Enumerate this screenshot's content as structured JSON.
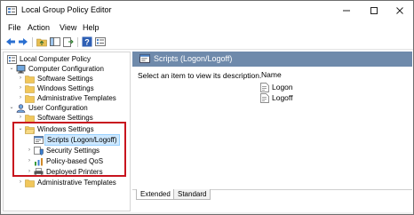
{
  "window": {
    "title": "Local Group Policy Editor"
  },
  "menu": [
    "File",
    "Action",
    "View",
    "Help"
  ],
  "toolbar": {
    "icons": [
      "back-arrow-icon",
      "forward-arrow-icon",
      "up-folder-icon",
      "show-hide-tree-icon",
      "export-list-icon",
      "help-icon",
      "properties-icon"
    ]
  },
  "tree": [
    {
      "label": "Local Computer Policy",
      "icon": "computer-policy-icon"
    },
    {
      "label": "Computer Configuration",
      "icon": "computer-icon"
    },
    {
      "label": "Software Settings",
      "icon": "folder-icon"
    },
    {
      "label": "Windows Settings",
      "icon": "folder-icon"
    },
    {
      "label": "Administrative Templates",
      "icon": "folder-icon"
    },
    {
      "label": "User Configuration",
      "icon": "user-icon"
    },
    {
      "label": "Software Settings",
      "icon": "folder-icon"
    },
    {
      "label": "Windows Settings",
      "icon": "folder-open-icon"
    },
    {
      "label": "Scripts (Logon/Logoff)",
      "icon": "scripts-icon",
      "selected": true
    },
    {
      "label": "Security Settings",
      "icon": "security-icon"
    },
    {
      "label": "Policy-based QoS",
      "icon": "qos-icon"
    },
    {
      "label": "Deployed Printers",
      "icon": "printer-icon"
    },
    {
      "label": "Administrative Templates",
      "icon": "folder-icon"
    }
  ],
  "right_pane": {
    "header": "Scripts (Logon/Logoff)",
    "description": "Select an item to view its description.",
    "column_header": "Name",
    "items": [
      "Logon",
      "Logoff"
    ]
  },
  "tabs": [
    "Extended",
    "Standard"
  ],
  "colors": {
    "header": "#6f8aab",
    "highlight_box": "#c8141e",
    "selection": "#cde8ff"
  }
}
